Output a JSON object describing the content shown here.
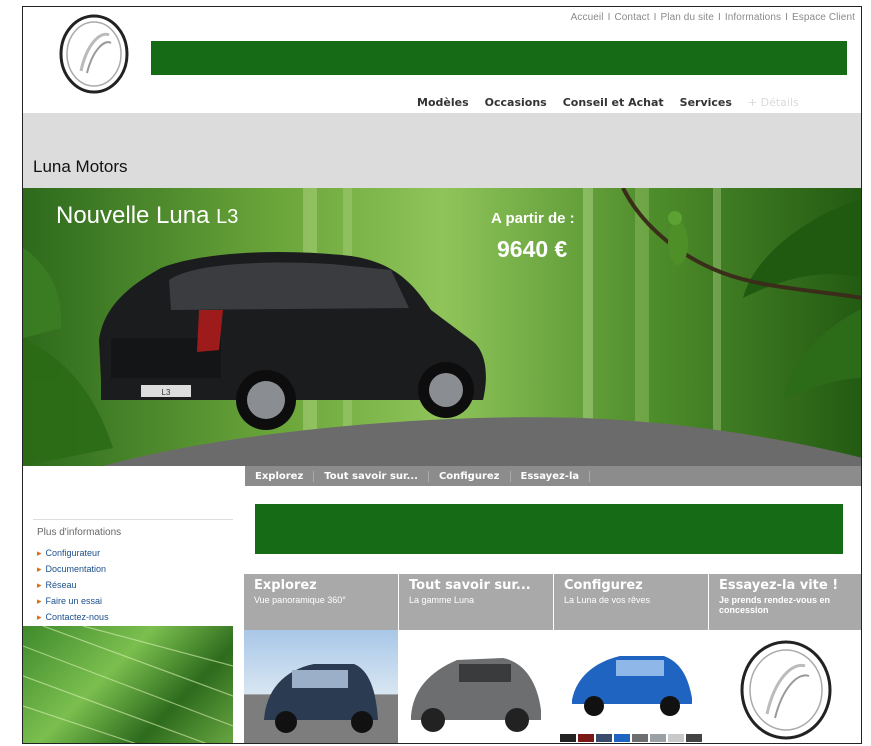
{
  "header": {
    "toplinks": [
      "Accueil",
      "Contact",
      "Plan du site",
      "Informations",
      "Espace Client"
    ],
    "nav": [
      "Modèles",
      "Occasions",
      "Conseil et Achat",
      "Services"
    ],
    "nav_faded": "+ Détails"
  },
  "brand": "Luna Motors",
  "hero": {
    "title": "Nouvelle Luna",
    "model": "L3",
    "price_label": "A partir de :",
    "price": "9640 €",
    "plate": "L3"
  },
  "subnav": [
    "Explorez",
    "Tout savoir sur...",
    "Configurez",
    "Essayez-la"
  ],
  "sidebar": {
    "title": "Plus d'informations",
    "items": [
      "Configurateur",
      "Documentation",
      "Réseau",
      "Faire un essai",
      "Contactez-nous"
    ]
  },
  "tiles": [
    {
      "title": "Explorez",
      "subtitle": "Vue panoramique 360°",
      "car_color": "#2b3b52"
    },
    {
      "title": "Tout savoir sur...",
      "subtitle": "La gamme Luna",
      "car_color": "#6d6e70"
    },
    {
      "title": "Configurez",
      "subtitle": "La Luna de vos rêves",
      "car_color": "#1f64c0"
    },
    {
      "title": "Essayez-la vite !",
      "subtitle": "Je prends rendez-vous en concession",
      "car_color": ""
    }
  ],
  "colors": {
    "brand_green": "#156b16",
    "tile_grey": "#a9a9a9",
    "accent_orange": "#e06a10"
  }
}
